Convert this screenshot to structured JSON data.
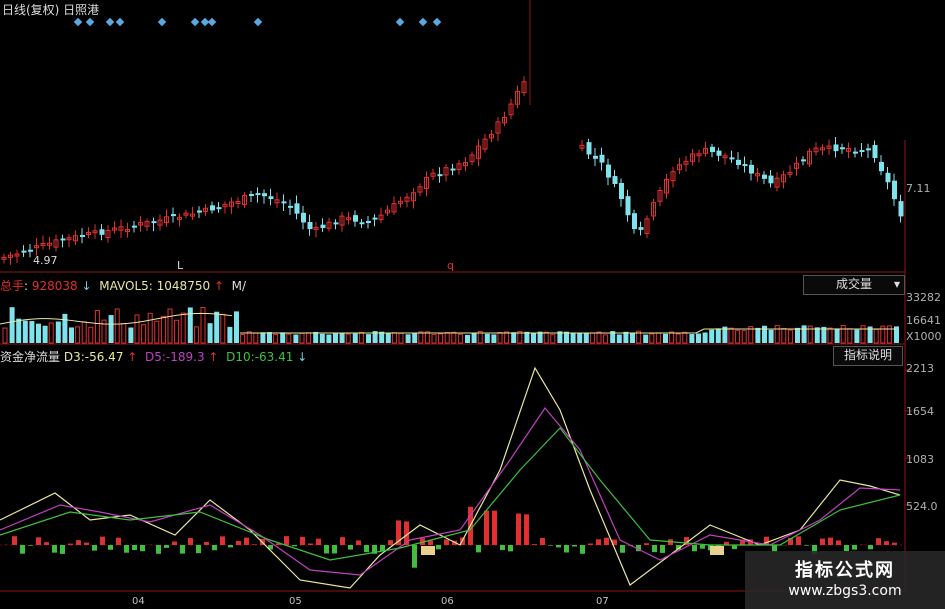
{
  "header": {
    "title": "日线(复权)  日照港"
  },
  "price": {
    "low_label": "4.97",
    "right_label": "7.11",
    "marker_L": "L",
    "marker_q": "q"
  },
  "volume": {
    "lead": "总手",
    "hand_value": "928038",
    "hand_arrow": "↓",
    "mavol5_label": "MAVOL5:",
    "mavol5_value": "1048750",
    "mavol5_arrow": "↑",
    "trailing": "M/",
    "button": "成交量",
    "dropdown_icon": "▾",
    "axis": [
      "33282",
      "16641",
      "X1000"
    ]
  },
  "indicator": {
    "name": "资金净流量",
    "d3_label": "D3:",
    "d3_value": "-56.47",
    "d3_arrow": "↑",
    "d5_label": "D5:",
    "d5_value": "-189.3",
    "d5_arrow": "↑",
    "d10_label": "D10:",
    "d10_value": "-63.41",
    "d10_arrow": "↓",
    "button": "指标说明",
    "axis": [
      "2213",
      "1654",
      "1083",
      "524.0"
    ]
  },
  "dates": [
    "04",
    "05",
    "06",
    "07"
  ],
  "watermark": {
    "line1": "指标公式网",
    "line2": "www.zbgs3.com"
  },
  "colors": {
    "up": "#e03030",
    "down": "#7fe3ee",
    "d3": "#e8e8a0",
    "d5": "#c040c0",
    "d10": "#40c040"
  }
}
